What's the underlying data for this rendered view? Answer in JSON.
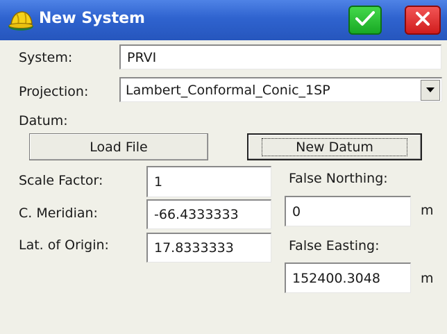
{
  "window": {
    "title": "New System",
    "ok_icon": "checkmark-icon",
    "close_icon": "close-x-icon"
  },
  "system": {
    "label": "System:",
    "value": "PRVI"
  },
  "projection": {
    "label": "Projection:",
    "value": "Lambert_Conformal_Conic_1SP"
  },
  "datum": {
    "label": "Datum:",
    "load_file_label": "Load File",
    "new_datum_label": "New Datum"
  },
  "scale_factor": {
    "label": "Scale Factor:",
    "value": "1"
  },
  "central_meridian": {
    "label": "C. Meridian:",
    "value": "-66.4333333"
  },
  "lat_of_origin": {
    "label": "Lat. of Origin:",
    "value": "17.8333333"
  },
  "false_northing": {
    "label": "False Northing:",
    "value": "0",
    "unit": "m"
  },
  "false_easting": {
    "label": "False Easting:",
    "value": "152400.3048",
    "unit": "m"
  },
  "colors": {
    "titlebar": "#2f63cf",
    "ok": "#19a925",
    "close": "#d01d1d"
  }
}
